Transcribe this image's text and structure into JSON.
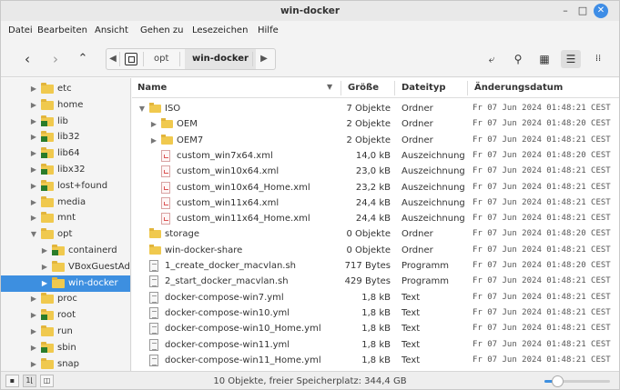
{
  "window": {
    "title": "win-docker",
    "controls": {
      "minimize": "–",
      "maximize": "□",
      "close": "✕"
    }
  },
  "menu": [
    "Datei",
    "Bearbeiten",
    "Ansicht",
    "Gehen zu",
    "Lesezeichen",
    "Hilfe"
  ],
  "toolbar": {
    "back_icon": "arrow-left-icon",
    "forward_icon": "arrow-right-icon",
    "up_icon": "arrow-up-icon",
    "breadcrumb": [
      "opt",
      "win-docker"
    ],
    "right_tools": [
      "open-terminal-icon",
      "search-icon",
      "grid-view-icon",
      "list-view-icon",
      "compact-view-icon"
    ]
  },
  "sidebar": {
    "items": [
      {
        "label": "etc",
        "expanded": false,
        "linked": false,
        "depth": 0
      },
      {
        "label": "home",
        "expanded": false,
        "linked": false,
        "depth": 0
      },
      {
        "label": "lib",
        "expanded": false,
        "linked": true,
        "depth": 0
      },
      {
        "label": "lib32",
        "expanded": false,
        "linked": true,
        "depth": 0
      },
      {
        "label": "lib64",
        "expanded": false,
        "linked": true,
        "depth": 0
      },
      {
        "label": "libx32",
        "expanded": false,
        "linked": true,
        "depth": 0
      },
      {
        "label": "lost+found",
        "expanded": false,
        "linked": true,
        "depth": 0
      },
      {
        "label": "media",
        "expanded": false,
        "linked": false,
        "depth": 0
      },
      {
        "label": "mnt",
        "expanded": false,
        "linked": false,
        "depth": 0
      },
      {
        "label": "opt",
        "expanded": true,
        "linked": false,
        "depth": 0
      },
      {
        "label": "containerd",
        "expanded": false,
        "linked": true,
        "depth": 1
      },
      {
        "label": "VBoxGuestAdditions",
        "expanded": false,
        "linked": false,
        "depth": 1
      },
      {
        "label": "win-docker",
        "expanded": false,
        "linked": false,
        "depth": 1,
        "selected": true
      },
      {
        "label": "proc",
        "expanded": false,
        "linked": false,
        "depth": 0
      },
      {
        "label": "root",
        "expanded": false,
        "linked": true,
        "depth": 0
      },
      {
        "label": "run",
        "expanded": false,
        "linked": false,
        "depth": 0
      },
      {
        "label": "sbin",
        "expanded": false,
        "linked": true,
        "depth": 0
      },
      {
        "label": "snap",
        "expanded": false,
        "linked": false,
        "depth": 0
      }
    ]
  },
  "columns": {
    "name": "Name",
    "size": "Größe",
    "type": "Dateityp",
    "date": "Änderungsdatum"
  },
  "files": [
    {
      "name": "ISO",
      "size": "7 Objekte",
      "type": "Ordner",
      "date": "Fr 07 Jun 2024 01:48:21 CEST",
      "kind": "folder",
      "depth": 0,
      "arrow": "▼"
    },
    {
      "name": "OEM",
      "size": "2 Objekte",
      "type": "Ordner",
      "date": "Fr 07 Jun 2024 01:48:20 CEST",
      "kind": "folder",
      "depth": 1,
      "arrow": "▶"
    },
    {
      "name": "OEM7",
      "size": "2 Objekte",
      "type": "Ordner",
      "date": "Fr 07 Jun 2024 01:48:21 CEST",
      "kind": "folder",
      "depth": 1,
      "arrow": "▶"
    },
    {
      "name": "custom_win7x64.xml",
      "size": "14,0 kB",
      "type": "Auszeichnung",
      "date": "Fr 07 Jun 2024 01:48:20 CEST",
      "kind": "xml",
      "depth": 1
    },
    {
      "name": "custom_win10x64.xml",
      "size": "23,0 kB",
      "type": "Auszeichnung",
      "date": "Fr 07 Jun 2024 01:48:21 CEST",
      "kind": "xml",
      "depth": 1
    },
    {
      "name": "custom_win10x64_Home.xml",
      "size": "23,2 kB",
      "type": "Auszeichnung",
      "date": "Fr 07 Jun 2024 01:48:21 CEST",
      "kind": "xml",
      "depth": 1
    },
    {
      "name": "custom_win11x64.xml",
      "size": "24,4 kB",
      "type": "Auszeichnung",
      "date": "Fr 07 Jun 2024 01:48:21 CEST",
      "kind": "xml",
      "depth": 1
    },
    {
      "name": "custom_win11x64_Home.xml",
      "size": "24,4 kB",
      "type": "Auszeichnung",
      "date": "Fr 07 Jun 2024 01:48:21 CEST",
      "kind": "xml",
      "depth": 1
    },
    {
      "name": "storage",
      "size": "0 Objekte",
      "type": "Ordner",
      "date": "Fr 07 Jun 2024 01:48:20 CEST",
      "kind": "folder",
      "depth": 0
    },
    {
      "name": "win-docker-share",
      "size": "0 Objekte",
      "type": "Ordner",
      "date": "Fr 07 Jun 2024 01:48:21 CEST",
      "kind": "folder",
      "depth": 0
    },
    {
      "name": "1_create_docker_macvlan.sh",
      "size": "717 Bytes",
      "type": "Programm",
      "date": "Fr 07 Jun 2024 01:48:20 CEST",
      "kind": "doc",
      "depth": 0
    },
    {
      "name": "2_start_docker_macvlan.sh",
      "size": "429 Bytes",
      "type": "Programm",
      "date": "Fr 07 Jun 2024 01:48:21 CEST",
      "kind": "doc",
      "depth": 0
    },
    {
      "name": "docker-compose-win7.yml",
      "size": "1,8 kB",
      "type": "Text",
      "date": "Fr 07 Jun 2024 01:48:21 CEST",
      "kind": "doc",
      "depth": 0
    },
    {
      "name": "docker-compose-win10.yml",
      "size": "1,8 kB",
      "type": "Text",
      "date": "Fr 07 Jun 2024 01:48:21 CEST",
      "kind": "doc",
      "depth": 0
    },
    {
      "name": "docker-compose-win10_Home.yml",
      "size": "1,8 kB",
      "type": "Text",
      "date": "Fr 07 Jun 2024 01:48:21 CEST",
      "kind": "doc",
      "depth": 0
    },
    {
      "name": "docker-compose-win11.yml",
      "size": "1,8 kB",
      "type": "Text",
      "date": "Fr 07 Jun 2024 01:48:21 CEST",
      "kind": "doc",
      "depth": 0
    },
    {
      "name": "docker-compose-win11_Home.yml",
      "size": "1,8 kB",
      "type": "Text",
      "date": "Fr 07 Jun 2024 01:48:21 CEST",
      "kind": "doc",
      "depth": 0
    }
  ],
  "status": {
    "text": "10 Objekte, freier Speicherplatz: 344,4 GB",
    "zoom_level": 0.2
  },
  "colors": {
    "accent": "#3d8fe0",
    "folder": "#f0c94e"
  }
}
